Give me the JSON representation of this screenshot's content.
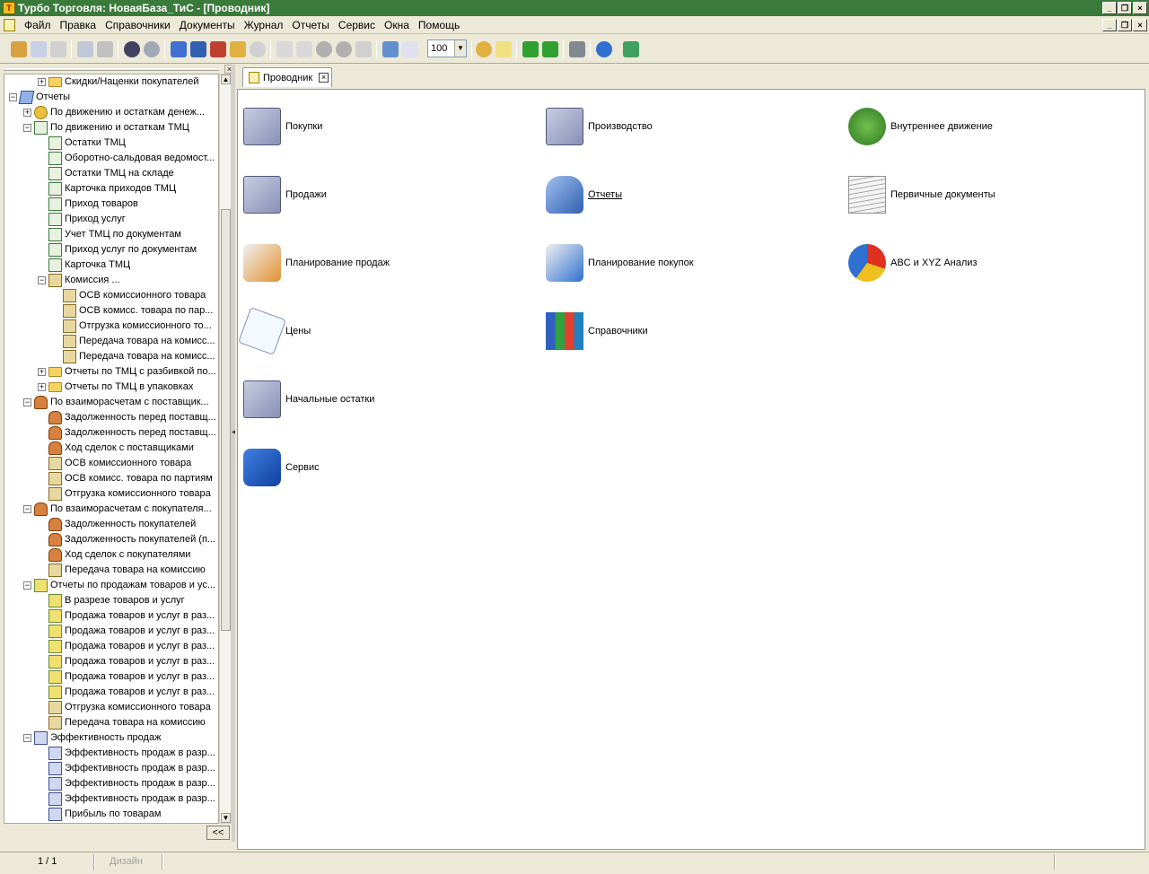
{
  "window": {
    "title": "Турбо Торговля: НоваяБаза_ТиС - [Проводник]",
    "min_glyph": "_",
    "restore_glyph": "❐",
    "close_glyph": "×"
  },
  "menu": {
    "items": [
      "Файл",
      "Правка",
      "Справочники",
      "Документы",
      "Журнал",
      "Отчеты",
      "Сервис",
      "Окна",
      "Помощь"
    ]
  },
  "toolbar": {
    "zoom_value": "100",
    "dropdown_glyph": "▼"
  },
  "sidebar": {
    "close_glyph": "×",
    "collapse_label": "<<",
    "tree": [
      {
        "label": "Скидки/Наценки покупателей",
        "level": 2,
        "expander": "+",
        "icon": "folder-icon"
      },
      {
        "label": "Отчеты",
        "level": 0,
        "expander": "−",
        "icon": "reports-book-icon"
      },
      {
        "label": "По движению и остаткам денеж...",
        "level": 1,
        "expander": "+",
        "icon": "coins-icon"
      },
      {
        "label": "По движению и остаткам ТМЦ",
        "level": 1,
        "expander": "−",
        "icon": "goods-report-icon"
      },
      {
        "label": "Остатки ТМЦ",
        "level": 2,
        "expander": "",
        "icon": "report-icon"
      },
      {
        "label": "Оборотно-сальдовая ведомост...",
        "level": 2,
        "expander": "",
        "icon": "report-icon"
      },
      {
        "label": "Остатки ТМЦ на складе",
        "level": 2,
        "expander": "",
        "icon": "report-icon"
      },
      {
        "label": "Карточка приходов ТМЦ",
        "level": 2,
        "expander": "",
        "icon": "report-icon"
      },
      {
        "label": "Приход товаров",
        "level": 2,
        "expander": "",
        "icon": "report-icon"
      },
      {
        "label": "Приход услуг",
        "level": 2,
        "expander": "",
        "icon": "report-icon"
      },
      {
        "label": "Учет ТМЦ по документам",
        "level": 2,
        "expander": "",
        "icon": "report-icon"
      },
      {
        "label": "Приход услуг по документам",
        "level": 2,
        "expander": "",
        "icon": "report-icon"
      },
      {
        "label": "Карточка ТМЦ",
        "level": 2,
        "expander": "",
        "icon": "report-icon"
      },
      {
        "label": "Комиссия ...",
        "level": 2,
        "expander": "−",
        "icon": "commission-icon"
      },
      {
        "label": "ОСВ комиссионного товара",
        "level": 3,
        "expander": "",
        "icon": "commission-icon"
      },
      {
        "label": "ОСВ комисс. товара по пар...",
        "level": 3,
        "expander": "",
        "icon": "commission-icon"
      },
      {
        "label": "Отгрузка комиссионного то...",
        "level": 3,
        "expander": "",
        "icon": "commission-icon"
      },
      {
        "label": "Передача товара на комисс...",
        "level": 3,
        "expander": "",
        "icon": "commission-icon"
      },
      {
        "label": "Передача товара на комисс...",
        "level": 3,
        "expander": "",
        "icon": "commission-icon"
      },
      {
        "label": "Отчеты по ТМЦ с разбивкой по...",
        "level": 2,
        "expander": "+",
        "icon": "folder-icon"
      },
      {
        "label": "Отчеты по ТМЦ в упаковках",
        "level": 2,
        "expander": "+",
        "icon": "folder-icon"
      },
      {
        "label": "По взаиморасчетам с поставщик...",
        "level": 1,
        "expander": "−",
        "icon": "person-icon"
      },
      {
        "label": "Задолженность перед поставщ...",
        "level": 2,
        "expander": "",
        "icon": "person-report-icon"
      },
      {
        "label": "Задолженность перед поставщ...",
        "level": 2,
        "expander": "",
        "icon": "person-report-icon"
      },
      {
        "label": "Ход сделок с поставщиками",
        "level": 2,
        "expander": "",
        "icon": "person-report-icon"
      },
      {
        "label": "ОСВ комиссионного товара",
        "level": 2,
        "expander": "",
        "icon": "commission-icon"
      },
      {
        "label": "ОСВ комисс. товара по партиям",
        "level": 2,
        "expander": "",
        "icon": "commission-icon"
      },
      {
        "label": "Отгрузка комиссионного товара",
        "level": 2,
        "expander": "",
        "icon": "commission-icon"
      },
      {
        "label": "По взаиморасчетам с покупателя...",
        "level": 1,
        "expander": "−",
        "icon": "person-icon"
      },
      {
        "label": "Задолженность покупателей",
        "level": 2,
        "expander": "",
        "icon": "person-report-icon"
      },
      {
        "label": "Задолженность покупателей (п...",
        "level": 2,
        "expander": "",
        "icon": "person-report-icon"
      },
      {
        "label": "Ход сделок с покупателями",
        "level": 2,
        "expander": "",
        "icon": "person-report-icon"
      },
      {
        "label": "Передача товара на комиссию",
        "level": 2,
        "expander": "",
        "icon": "commission-icon"
      },
      {
        "label": "Отчеты по продажам товаров и ус...",
        "level": 1,
        "expander": "−",
        "icon": "sales-icon"
      },
      {
        "label": "В разрезе товаров и услуг",
        "level": 2,
        "expander": "",
        "icon": "sales-icon"
      },
      {
        "label": "Продажа товаров и услуг в раз...",
        "level": 2,
        "expander": "",
        "icon": "sales-icon"
      },
      {
        "label": "Продажа товаров и услуг в раз...",
        "level": 2,
        "expander": "",
        "icon": "sales-icon"
      },
      {
        "label": "Продажа товаров и услуг в раз...",
        "level": 2,
        "expander": "",
        "icon": "sales-icon"
      },
      {
        "label": "Продажа товаров и услуг в раз...",
        "level": 2,
        "expander": "",
        "icon": "sales-icon"
      },
      {
        "label": "Продажа товаров и услуг в раз...",
        "level": 2,
        "expander": "",
        "icon": "sales-icon"
      },
      {
        "label": "Продажа товаров и услуг в раз...",
        "level": 2,
        "expander": "",
        "icon": "sales-icon"
      },
      {
        "label": "Отгрузка комиссионного товара",
        "level": 2,
        "expander": "",
        "icon": "commission-icon"
      },
      {
        "label": "Передача товара на комиссию",
        "level": 2,
        "expander": "",
        "icon": "commission-icon"
      },
      {
        "label": "Эффективность продаж",
        "level": 1,
        "expander": "−",
        "icon": "chart-icon"
      },
      {
        "label": "Эффективность продаж в разр...",
        "level": 2,
        "expander": "",
        "icon": "chart-icon"
      },
      {
        "label": "Эффективность продаж в разр...",
        "level": 2,
        "expander": "",
        "icon": "chart-icon"
      },
      {
        "label": "Эффективность продаж в разр...",
        "level": 2,
        "expander": "",
        "icon": "chart-icon"
      },
      {
        "label": "Эффективность продаж в разр...",
        "level": 2,
        "expander": "",
        "icon": "chart-icon"
      },
      {
        "label": "Прибыль по товарам",
        "level": 2,
        "expander": "",
        "icon": "chart-icon"
      }
    ]
  },
  "tab": {
    "label": "Проводник",
    "close_glyph": "×"
  },
  "explorer": {
    "items": [
      {
        "label": "Покупки",
        "icon": "purchases-cabinet-icon",
        "col": 0,
        "row": 0
      },
      {
        "label": "Производство",
        "icon": "production-cabinet-icon",
        "col": 1,
        "row": 0
      },
      {
        "label": "Внутреннее движение",
        "icon": "internal-movement-icon",
        "col": 2,
        "row": 0
      },
      {
        "label": "Продажи",
        "icon": "sales-cabinet-icon",
        "col": 0,
        "row": 1
      },
      {
        "label": "Отчеты",
        "icon": "reports-book-icon",
        "col": 1,
        "row": 1,
        "link": true
      },
      {
        "label": "Первичные документы",
        "icon": "documents-stack-icon",
        "col": 2,
        "row": 1
      },
      {
        "label": "Планирование продаж",
        "icon": "sales-planning-icon",
        "col": 0,
        "row": 2
      },
      {
        "label": "Планирование покупок",
        "icon": "purchase-planning-icon",
        "col": 1,
        "row": 2
      },
      {
        "label": "ABC и XYZ Анализ",
        "icon": "abc-xyz-chart-icon",
        "col": 2,
        "row": 2
      },
      {
        "label": "Цены",
        "icon": "price-tag-icon",
        "col": 0,
        "row": 3
      },
      {
        "label": "Справочники",
        "icon": "reference-books-icon",
        "col": 1,
        "row": 3
      },
      {
        "label": "Начальные остатки",
        "icon": "opening-balance-cabinet-icon",
        "col": 0,
        "row": 4
      },
      {
        "label": "Сервис",
        "icon": "service-tools-icon",
        "col": 0,
        "row": 5
      }
    ]
  },
  "status": {
    "page": "1 / 1",
    "mode": "Дизайн"
  }
}
